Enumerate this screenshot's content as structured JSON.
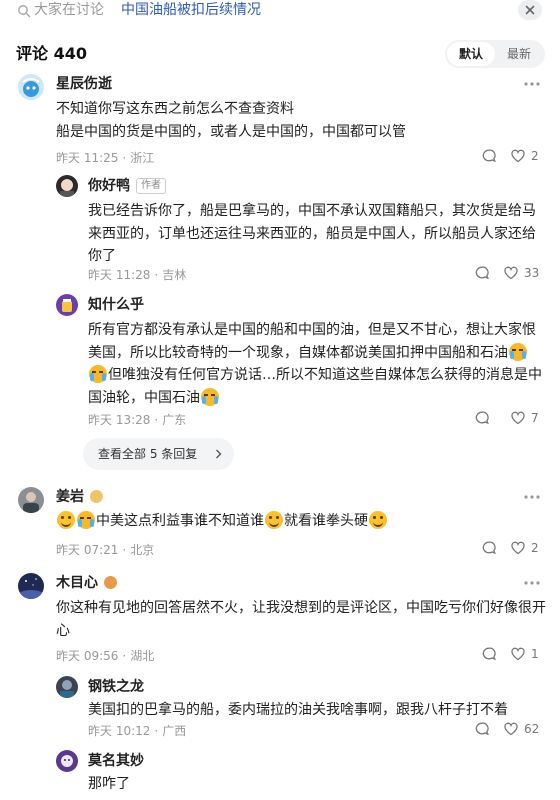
{
  "search": {
    "hint": "大家在讨论",
    "topic": "中国油船被扣后续情况"
  },
  "header": {
    "title": "评论",
    "count": "440",
    "sort_default": "默认",
    "sort_latest": "最新"
  },
  "comments": [
    {
      "user": "星辰伤逝",
      "text": "不知道你写这东西之前怎么不查查资料\n船是中国的货是中国的，或者人是中国的，中国都可以管",
      "time": "昨天 11:25",
      "location": "浙江",
      "likes": "2",
      "replies": [
        {
          "user": "你好鸭",
          "badge": "作者",
          "text": "我已经告诉你了，船是巴拿马的，中国不承认双国籍船只，其次货是给马来西亚的，订单也还运往马来西亚的，船员是中国人，所以船员人家还给你了",
          "time": "昨天 11:28",
          "location": "吉林",
          "likes": "33"
        },
        {
          "user": "知什么乎",
          "text_a": "所有官方都没有承认是中国的船和中国的油，但是又不甘心，想让大家恨美国，所以比较奇特的一个现象，自媒体都说美国扣押中国船和石油",
          "text_b": "但唯独没有任何官方说话…所以不知道这些自媒体怎么获得的消息是中国油轮，中国石油",
          "time": "昨天 13:28",
          "location": "广东",
          "likes": "7"
        }
      ],
      "view_more": "查看全部 5 条回复"
    },
    {
      "user": "姜岩",
      "text_a": "中美这点利益事谁不知道谁",
      "text_b": "就看谁拳头硬",
      "time": "昨天 07:21",
      "location": "北京",
      "likes": "2"
    },
    {
      "user": "木目心",
      "text": "你这种有见地的回答居然不火，让我没想到的是评论区，中国吃亏你们好像很开心",
      "time": "昨天 09:56",
      "location": "湖北",
      "likes": "1",
      "replies": [
        {
          "user": "钢铁之龙",
          "text": "美国扣的巴拿马的船，委内瑞拉的油关我啥事啊，跟我八杆子打不着",
          "time": "昨天 10:12",
          "location": "广西",
          "likes": "62"
        },
        {
          "user": "莫名其妙",
          "text": "那咋了"
        }
      ]
    }
  ],
  "colors": {
    "link": "#2f5bb7",
    "muted": "#999999",
    "text": "#222222"
  }
}
